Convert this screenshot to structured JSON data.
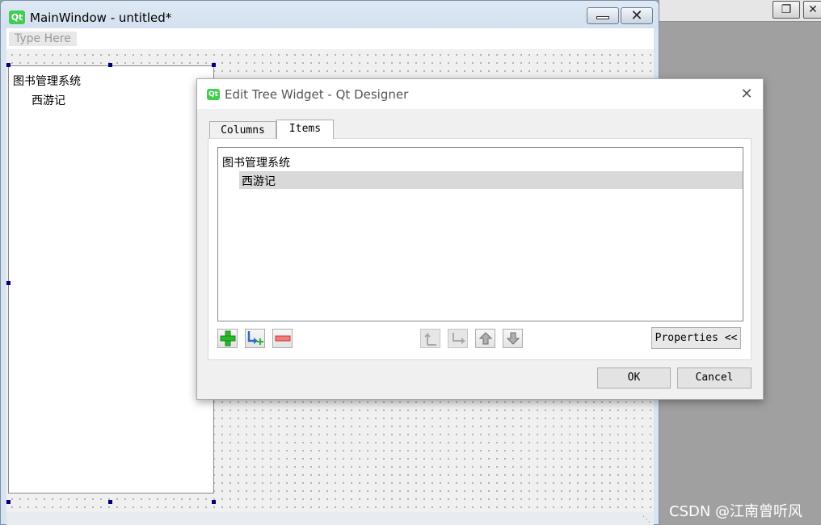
{
  "main_window": {
    "title": "MainWindow - untitled*",
    "logo_text": "Qt",
    "menubar": {
      "placeholder": "Type Here"
    },
    "tree_widget": {
      "root_item": "图书管理系统",
      "child_item": "西游记"
    }
  },
  "dialog": {
    "title": "Edit Tree Widget - Qt Designer",
    "logo_text": "Qt",
    "tabs": [
      {
        "label": "Columns",
        "active": false
      },
      {
        "label": "Items",
        "active": true
      }
    ],
    "items": [
      {
        "text": "图书管理系统",
        "level": 0,
        "selected": false
      },
      {
        "text": "西游记",
        "level": 1,
        "selected": true
      }
    ],
    "toolbar": {
      "icons": [
        "plus-icon",
        "new-subitem-icon",
        "minus-icon",
        "move-left-icon",
        "move-right-icon",
        "move-up-icon",
        "move-down-icon"
      ],
      "properties_label": "Properties <<"
    },
    "buttons": {
      "ok": "OK",
      "cancel": "Cancel"
    }
  },
  "watermark": "CSDN @江南曾听风",
  "colors": {
    "qt_green": "#41cd52",
    "selection": "#d9d9d9",
    "handle": "#00007f",
    "desktop": "#a0a0a0"
  }
}
